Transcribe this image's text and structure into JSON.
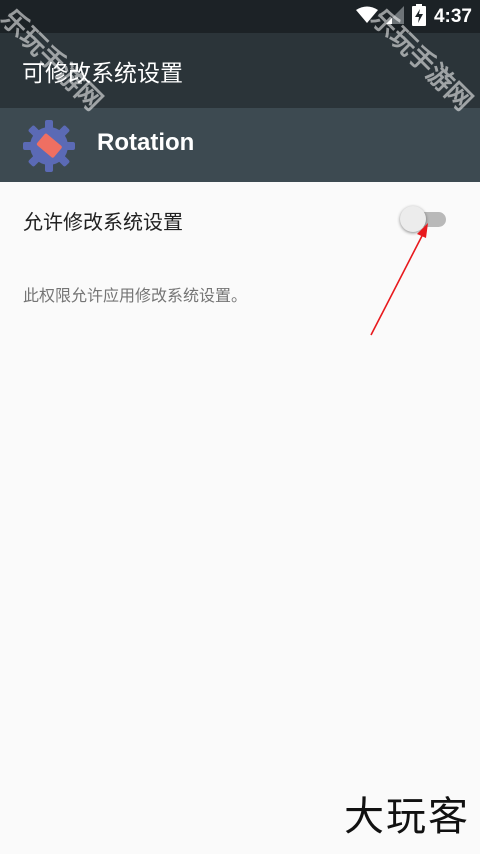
{
  "status_bar": {
    "time": "4:37",
    "icons": [
      "wifi-icon",
      "signal-icon",
      "battery-charging-icon"
    ]
  },
  "app_bar": {
    "title": "可修改系统设置"
  },
  "app_header": {
    "app_name": "Rotation",
    "icon": "rotation-app-icon"
  },
  "setting": {
    "label": "允许修改系统设置",
    "enabled": false,
    "description": "此权限允许应用修改系统设置。"
  },
  "watermarks": {
    "top_text": "乐玩手游网",
    "bottom_text": "大玩客"
  },
  "colors": {
    "status_bar": "#1c2226",
    "app_bar": "#2b3439",
    "app_header": "#3d4a51",
    "background": "#fafafa",
    "annotation_arrow": "#e8191d"
  }
}
